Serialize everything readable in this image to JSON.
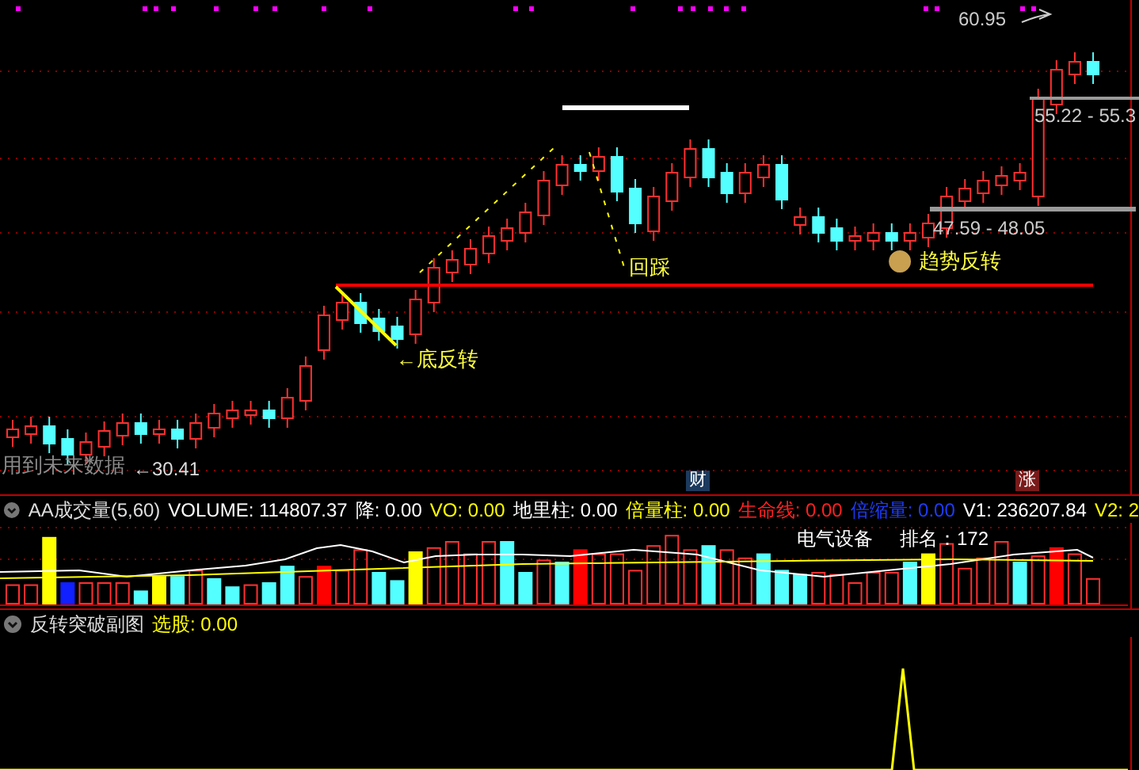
{
  "main_chart": {
    "annotations": [
      {
        "kind": "high",
        "text": "60.95"
      },
      {
        "kind": "range_upper",
        "text": "55.22 - 55.3"
      },
      {
        "kind": "range_lower",
        "text": "47.59 - 48.05"
      },
      {
        "kind": "signal_trend",
        "text": "趋势反转"
      },
      {
        "kind": "signal_pullback",
        "text": "回踩"
      },
      {
        "kind": "signal_bottom",
        "text": "←底反转"
      },
      {
        "kind": "low",
        "text": "←30.41"
      },
      {
        "kind": "warning",
        "text": "用到未来数据"
      }
    ],
    "badges": [
      {
        "text": "财",
        "color": "#1c3a5e"
      },
      {
        "text": "涨",
        "color": "#7a1a1a"
      }
    ]
  },
  "volume_panel": {
    "title": "AA成交量(5,60)",
    "indicators": [
      {
        "label": "VOLUME:",
        "value": "114807.37",
        "color": "#ffffff"
      },
      {
        "label": "降:",
        "value": "0.00",
        "color": "#ffffff"
      },
      {
        "label": "VO:",
        "value": "0.00",
        "color": "#ffff00"
      },
      {
        "label": "地里柱:",
        "value": "0.00",
        "color": "#ffffff"
      },
      {
        "label": "倍量柱:",
        "value": "0.00",
        "color": "#ffff00"
      },
      {
        "label": "生命线:",
        "value": "0.00",
        "color": "#ff2020"
      },
      {
        "label": "倍缩量:",
        "value": "0.00",
        "color": "#1e3cff"
      },
      {
        "label": "V1:",
        "value": "236207.84",
        "color": "#ffffff"
      },
      {
        "label": "V2:",
        "value": "2",
        "color": "#ffff00"
      }
    ],
    "sector": "电气设备",
    "rank": "排名：172"
  },
  "sub_panel": {
    "title": "反转突破副图",
    "indicators": [
      {
        "label": "选股:",
        "value": "0.00",
        "color": "#ffff00"
      }
    ]
  }
}
